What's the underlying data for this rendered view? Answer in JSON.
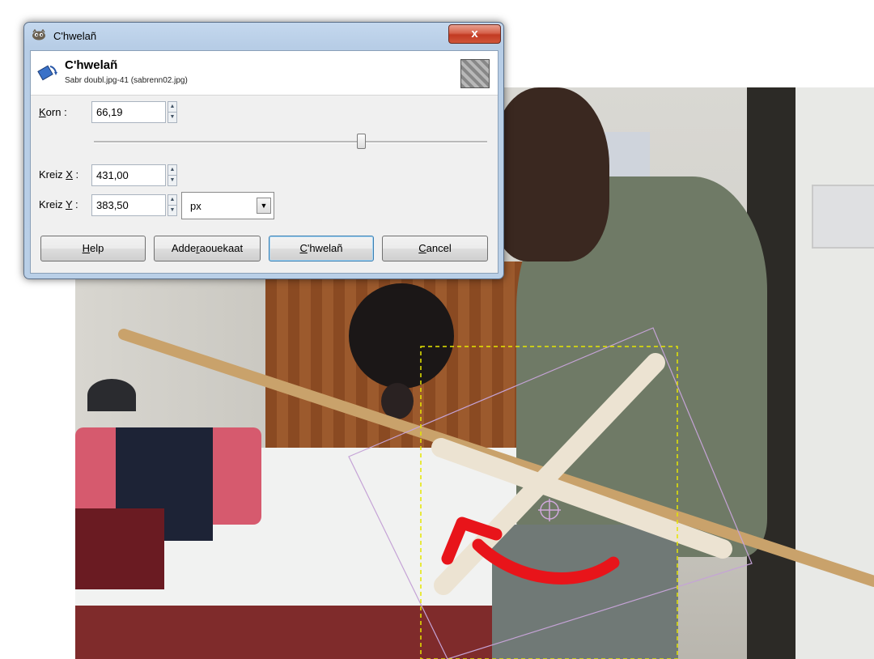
{
  "window": {
    "title": "C'hwelañ",
    "close_label": "x"
  },
  "header": {
    "title": "C'hwelañ",
    "subtitle": "Sabr doubl.jpg-41 (sabrenn02.jpg)"
  },
  "fields": {
    "korn": {
      "label_u": "K",
      "label_rest": "orn :",
      "value": "66,19"
    },
    "kreiz_x": {
      "label_pre": "Kreiz ",
      "label_u": "X",
      "label_post": " :",
      "value": "431,00"
    },
    "kreiz_y": {
      "label_pre": "Kreiz ",
      "label_u": "Y",
      "label_post": " :",
      "value": "383,50"
    },
    "unit": "px"
  },
  "slider": {
    "value_fraction": 0.68
  },
  "buttons": {
    "help": {
      "u": "H",
      "rest": "elp"
    },
    "adjust": {
      "pre": "Adde",
      "u": "r",
      "rest": "aouekaat"
    },
    "rotate": {
      "u": "C",
      "rest": "'hwelañ"
    },
    "cancel": {
      "u": "C",
      "rest": "ancel"
    }
  },
  "colors": {
    "dialog_frame": "#b9cfe7",
    "close_red": "#c23a22",
    "overlay_arrow": "#e8141a",
    "selection_marquee": "#e6e600",
    "rotate_frame": "#c5a3d6"
  },
  "icons": {
    "title": "gimp-wilber-icon",
    "header": "rotate-tool-icon",
    "close": "close-icon"
  }
}
